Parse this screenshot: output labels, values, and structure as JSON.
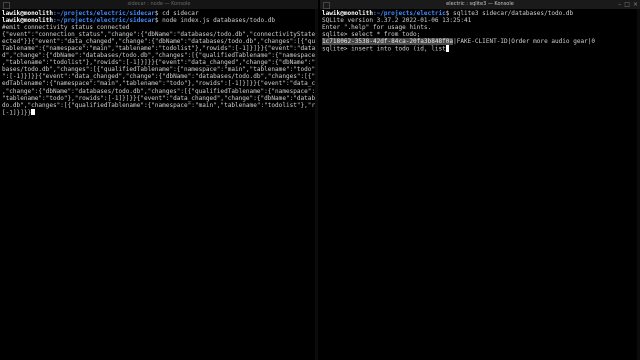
{
  "left_window": {
    "title": "sidecar : node — Konsole",
    "prompt_user": "lawik@monolith",
    "prompt_path": ":~/projects/electric/sidecar",
    "lines": [
      {
        "type": "prompt",
        "cmd": "$ cd sidecar"
      },
      {
        "type": "prompt",
        "cmd": "$ node index.js databases/todo.db"
      },
      {
        "type": "out",
        "text": "#emit connectivity status connected"
      },
      {
        "type": "out",
        "text": "{\"event\":\"connection_status\",\"change\":{\"dbName\":\"databases/todo.db\",\"connectivityState\":\"conn"
      },
      {
        "type": "out",
        "text": "ected\"}}{\"event\":\"data_changed\",\"change\":{\"dbName\":\"databases/todo.db\",\"changes\":[{\"qualified"
      },
      {
        "type": "out",
        "text": "Tablename\":{\"namespace\":\"main\",\"tablename\":\"todolist\"},\"rowids\":[-1]}]}}{\"event\":\"data_change"
      },
      {
        "type": "out",
        "text": "d\",\"change\":{\"dbName\":\"databases/todo.db\",\"changes\":[{\"qualifiedTablename\":{\"namespace\":\"main\""
      },
      {
        "type": "out",
        "text": ",\"tablename\":\"todolist\"},\"rowids\":[-1]}]}}{\"event\":\"data_changed\",\"change\":{\"dbName\":\"data"
      },
      {
        "type": "out",
        "text": "bases/todo.db\",\"changes\":[{\"qualifiedTablename\":{\"namespace\":\"main\",\"tablename\":\"todo\"},\"rowids"
      },
      {
        "type": "out",
        "text": "\":[-1]}]}}{\"event\":\"data_changed\",\"change\":{\"dbName\":\"databases/todo.db\",\"changes\":[{\"qualifi"
      },
      {
        "type": "out",
        "text": "edTablename\":{\"namespace\":\"main\",\"tablename\":\"todo\"},\"rowids\":[-1]}]}}{\"event\":\"data_changed\""
      },
      {
        "type": "out",
        "text": ",\"change\":{\"dbName\":\"databases/todo.db\",\"changes\":[{\"qualifiedTablename\":{\"namespace\":\"main\","
      },
      {
        "type": "out",
        "text": "\"tablename\":\"todo\"},\"rowids\":[-1]}]}}{\"event\":\"data_changed\",\"change\":{\"dbName\":\"databases/to"
      },
      {
        "type": "out",
        "text": "do.db\",\"changes\":[{\"qualifiedTablename\":{\"namespace\":\"main\",\"tablename\":\"todolist\"},\"rowids\":"
      },
      {
        "type": "out_cursor",
        "text": "[-1]}]}}"
      }
    ]
  },
  "right_window": {
    "title": "electric : sqlite3 — Konsole",
    "prompt_user": "lawik@monolith",
    "prompt_path": ":~/projects/electric",
    "lines": [
      {
        "type": "prompt",
        "cmd": "$ sqlite3 sidecar/databases/todo.db"
      },
      {
        "type": "out",
        "text": "SQLite version 3.37.2 2022-01-06 13:25:41"
      },
      {
        "type": "out",
        "text": "Enter \".help\" for usage hints."
      },
      {
        "type": "out",
        "text": "sqlite> select * from todo;"
      },
      {
        "type": "selrow",
        "sel": "1c718062-3538-42df-84ca-20fa3b848f0a",
        "rest": "|FAKE-CLIENT-ID|Order more audio gear|0"
      },
      {
        "type": "out_cursor",
        "text": "sqlite> insert into todo (id, list"
      }
    ]
  },
  "colors": {
    "background": "#000000",
    "text": "#d0d0d0",
    "prompt_user": "#ffffff",
    "prompt_path": "#3f8fff",
    "selection": "#4a4a4a"
  }
}
